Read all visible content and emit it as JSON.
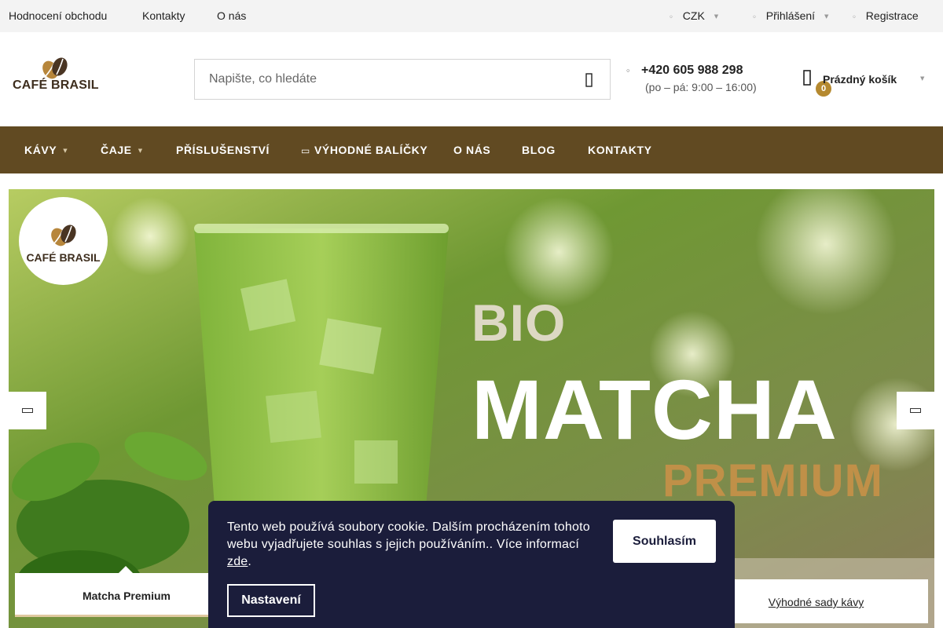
{
  "topbar": {
    "links": [
      "Hodnocení obchodu",
      "Kontakty",
      "O nás"
    ],
    "currency": "CZK",
    "login": "Přihlášení",
    "register": "Registrace"
  },
  "header": {
    "logo_text": "CAFÉ BRASIL",
    "search_placeholder": "Napište, co hledáte",
    "phone": "+420 605 988 298",
    "hours": "(po – pá: 9:00 – 16:00)",
    "cart_label": "Prázdný košík",
    "cart_count": "0"
  },
  "nav": {
    "items": [
      "KÁVY",
      "ČAJE",
      "PŘÍSLUŠENSTVÍ",
      "VÝHODNÉ BALÍČKY",
      "O NÁS",
      "BLOG",
      "KONTAKTY"
    ]
  },
  "hero": {
    "logo_text": "CAFÉ BRASIL",
    "line1": "BIO",
    "line2": "MATCHA",
    "line3": "PREMIUM",
    "slide_tabs": [
      "Matcha Premium",
      "Výhodné sady kávy"
    ]
  },
  "cookie": {
    "message": "Tento web používá soubory cookie. Dalším procházením tohoto webu vyjadřujete souhlas s jejich používáním.. Více informací ",
    "link": "zde",
    "suffix": ".",
    "agree": "Souhlasím",
    "settings": "Nastavení"
  },
  "colors": {
    "nav_bg": "#614a22",
    "cookie_bg": "#1b1d3b",
    "badge": "#b5892f",
    "premium_text": "#c09048"
  },
  "icons": [
    "globe-icon",
    "user-icon",
    "register-icon",
    "search-icon",
    "phone-icon",
    "cart-icon",
    "chevron-left-icon",
    "chevron-right-icon"
  ]
}
